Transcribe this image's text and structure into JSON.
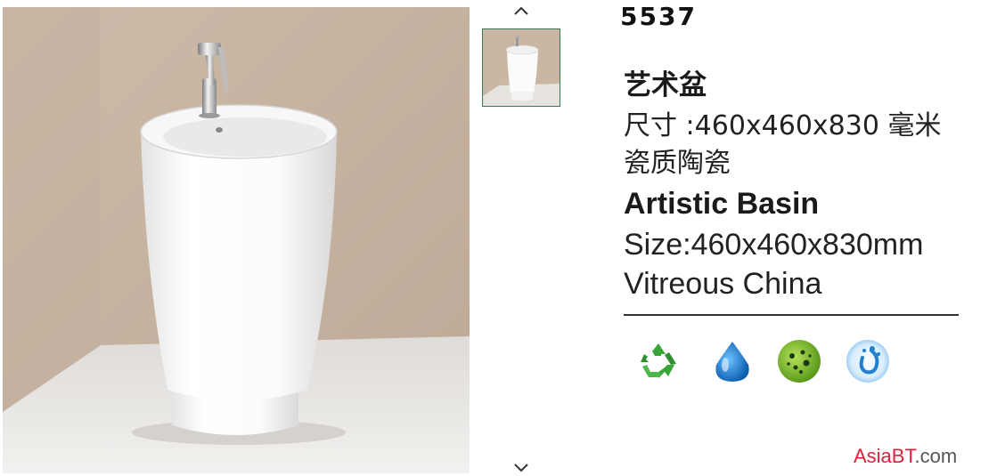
{
  "product": {
    "code": "5537",
    "cn_title": "艺术盆",
    "cn_size": "尺寸 :460x460x830 毫米",
    "cn_material": "瓷质陶瓷",
    "en_title": "Artistic Basin",
    "en_size": "Size:460x460x830mm",
    "en_material": "Vitreous China"
  },
  "gallery": {
    "up_icon": "chevron-up-icon",
    "down_icon": "chevron-down-icon"
  },
  "features": [
    {
      "icon": "recycle-icon",
      "color": "#3aa63a"
    },
    {
      "icon": "water-drop-icon",
      "color": "#1e7fd0"
    },
    {
      "icon": "antibacterial-icon",
      "color": "#7bbf2a"
    },
    {
      "icon": "water-splash-icon",
      "color": "#2a8fd8"
    }
  ],
  "watermark": {
    "brand": "AsiaBT",
    "tld": ".com"
  },
  "colors": {
    "wall": "#c9b6a3",
    "floor": "#e8e6e3",
    "ceramic": "#ffffff",
    "thumb_border": "#3a7a5a",
    "watermark_red": "#e0203a"
  }
}
